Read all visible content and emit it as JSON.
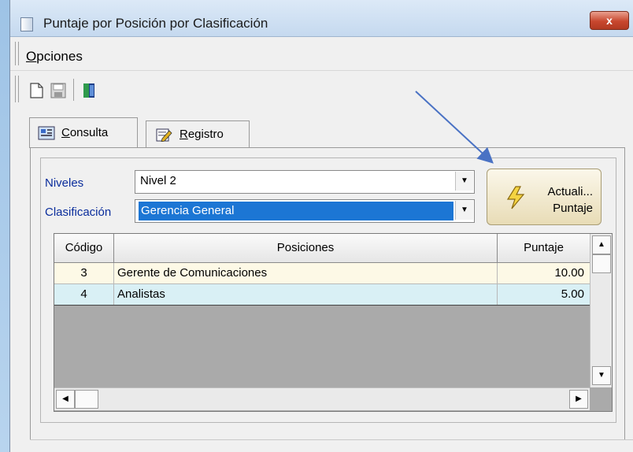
{
  "window": {
    "title": "Puntaje por Posición por Clasificación",
    "close_symbol": "x",
    "icon": "window-icon"
  },
  "menu": {
    "items": [
      {
        "label_first": "O",
        "label_rest": "pciones"
      }
    ]
  },
  "toolbar": {
    "icons": [
      "new-document-icon",
      "save-icon",
      "exit-door-icon"
    ]
  },
  "tabs": [
    {
      "label_first": "C",
      "label_rest": "onsulta",
      "icon": "query-icon",
      "selected": true
    },
    {
      "label_first": "R",
      "label_rest": "egistro",
      "icon": "edit-icon",
      "selected": false
    }
  ],
  "form": {
    "niveles_label": "Niveles",
    "niveles_value": "Nivel 2",
    "clasificacion_label": "Clasificación",
    "clasificacion_value": "Gerencia General"
  },
  "action_button": {
    "line1": "Actuali...",
    "line2": "Puntaje",
    "icon": "lightning-icon"
  },
  "grid": {
    "columns": [
      "Código",
      "Posiciones",
      "Puntaje"
    ],
    "rows": [
      {
        "codigo": "3",
        "posicion": "Gerente de Comunicaciones",
        "puntaje": "10.00"
      },
      {
        "codigo": "4",
        "posicion": "Analistas",
        "puntaje": "5.00"
      }
    ]
  },
  "colors": {
    "label_blue": "#0a2d9c",
    "selection_blue": "#1c76d4",
    "row1_bg": "#fdf9e6",
    "row2_bg": "#d9f0f5",
    "annotation_arrow": "#4a72c4"
  }
}
